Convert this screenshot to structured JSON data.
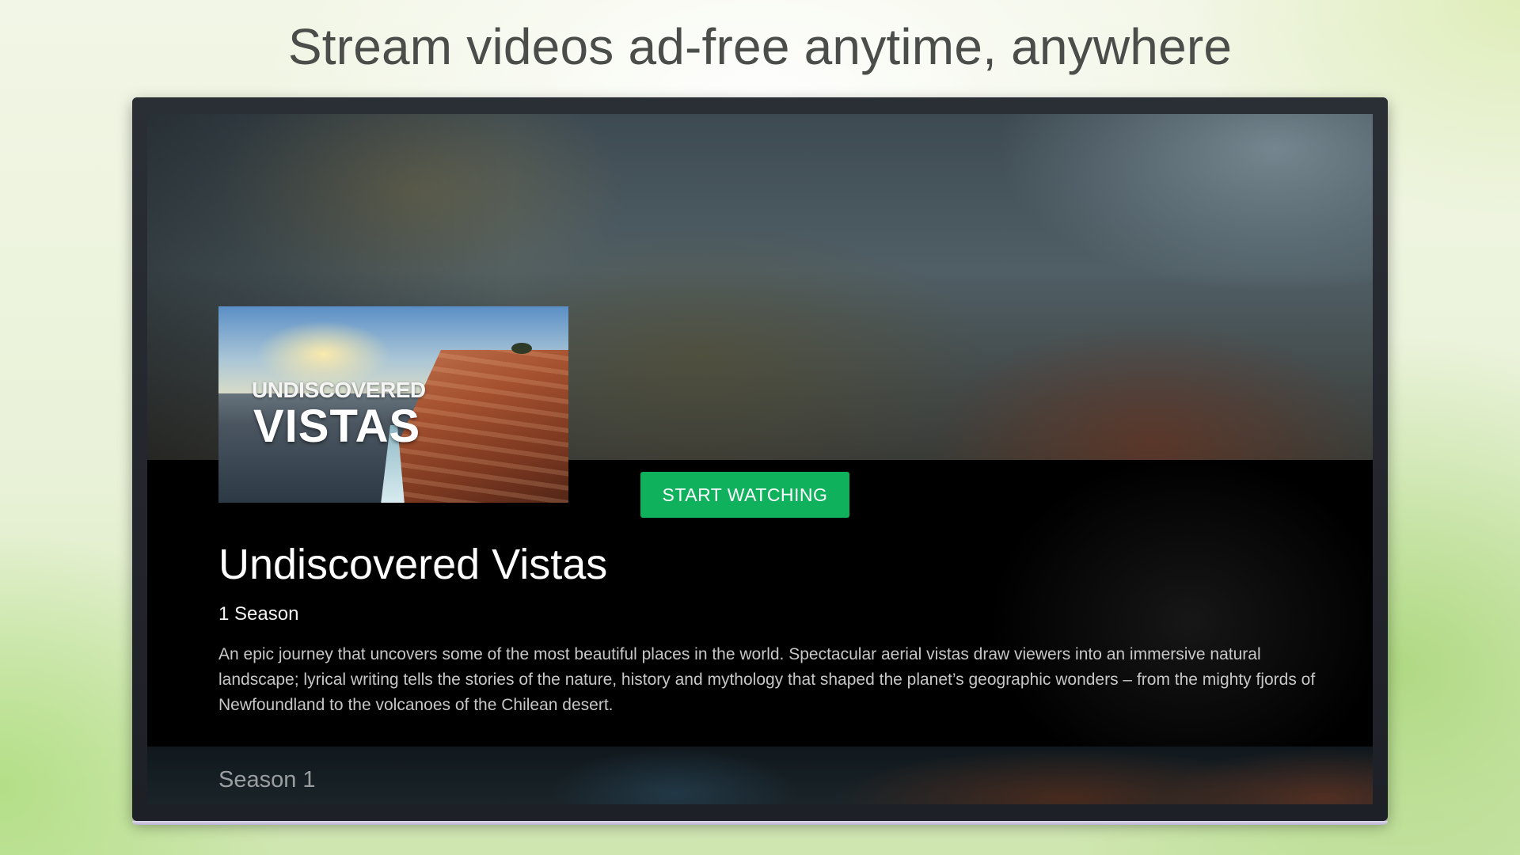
{
  "headline": "Stream videos ad-free anytime, anywhere",
  "show": {
    "poster_text_top": "UNDISCOVERED",
    "poster_text_main": "VISTAS",
    "title": "Undiscovered Vistas",
    "season_count": "1 Season",
    "description": "An epic journey that uncovers some of the most beautiful places in the world. Spectacular aerial vistas draw viewers into an immersive natural landscape; lyrical writing tells the stories of the nature, history and mythology that shaped the planet’s geographic wonders – from the mighty fjords of Newfoundland to the volcanoes of the Chilean desert."
  },
  "actions": {
    "start_watching": "START WATCHING"
  },
  "seasons": {
    "first_label": "Season 1"
  },
  "colors": {
    "accent": "#0fb15c",
    "headline_text": "#4a4d4a",
    "panel_background": "#000000"
  }
}
